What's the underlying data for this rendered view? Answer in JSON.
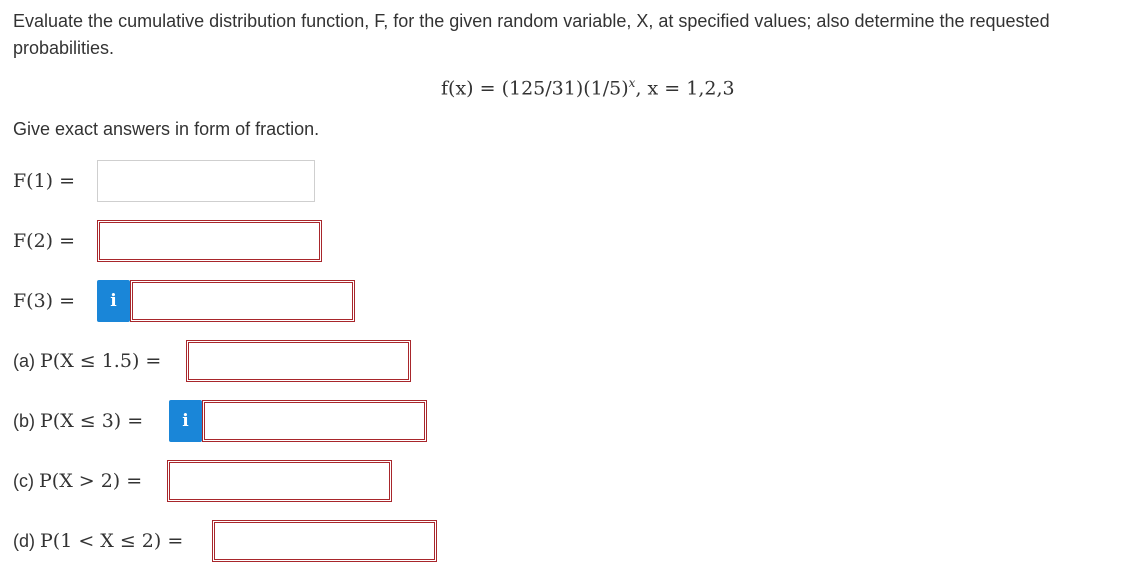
{
  "question": {
    "text": "Evaluate the cumulative distribution function, F, for the given random variable, X, at specified values; also determine the requested probabilities."
  },
  "formula": {
    "lhs": "f(x)",
    "eq": " = ",
    "rhs": "(125/31)(1/5)",
    "exp": "x",
    "tail": ", x = 1,2,3"
  },
  "instruction": "Give exact answers in form of fraction.",
  "fields": [
    {
      "part": "",
      "expr": "F(1) =",
      "value": ""
    },
    {
      "part": "",
      "expr": "F(2) =",
      "value": ""
    },
    {
      "part": "",
      "expr": "F(3) =",
      "value": ""
    },
    {
      "part": "(a) ",
      "expr": "P(X ≤ 1.5) =",
      "value": ""
    },
    {
      "part": "(b) ",
      "expr": "P(X ≤ 3) =",
      "value": ""
    },
    {
      "part": "(c) ",
      "expr": "P(X > 2) =",
      "value": ""
    },
    {
      "part": "(d) ",
      "expr": "P(1 < X ≤ 2) =",
      "value": ""
    }
  ],
  "info_icon": {
    "glyph": "i",
    "name": "info-icon"
  },
  "colors": {
    "error_border": "#a8262b",
    "info_button": "#1a86d8",
    "neutral_border": "#cfcfcf",
    "text": "#333333"
  }
}
